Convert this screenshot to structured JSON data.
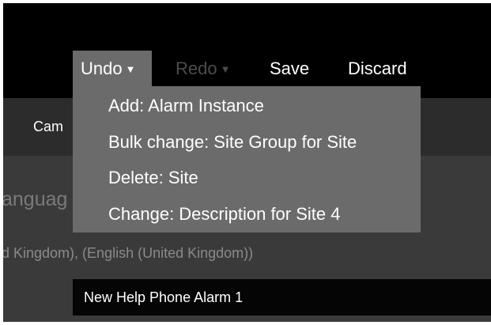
{
  "toolbar": {
    "undo_label": "Undo",
    "redo_label": "Redo",
    "save_label": "Save",
    "discard_label": "Discard",
    "caret": "▼"
  },
  "undo_menu": {
    "items": [
      "Add:  Alarm Instance",
      "Bulk change: Site Group for Site",
      "Delete:  Site",
      "Change: Description for Site 4"
    ]
  },
  "nav": {
    "tab_label": "Cam"
  },
  "form": {
    "language_label": "anguag",
    "language_value": "d Kingdom), (English (United Kingdom))",
    "name_value": "New Help Phone Alarm 1"
  },
  "colors": {
    "background": "#000000",
    "navbar": "#2c2c2c",
    "content": "#3a3a3a",
    "menu": "#6b6b6b",
    "disabled_text": "#4d4d4d"
  }
}
